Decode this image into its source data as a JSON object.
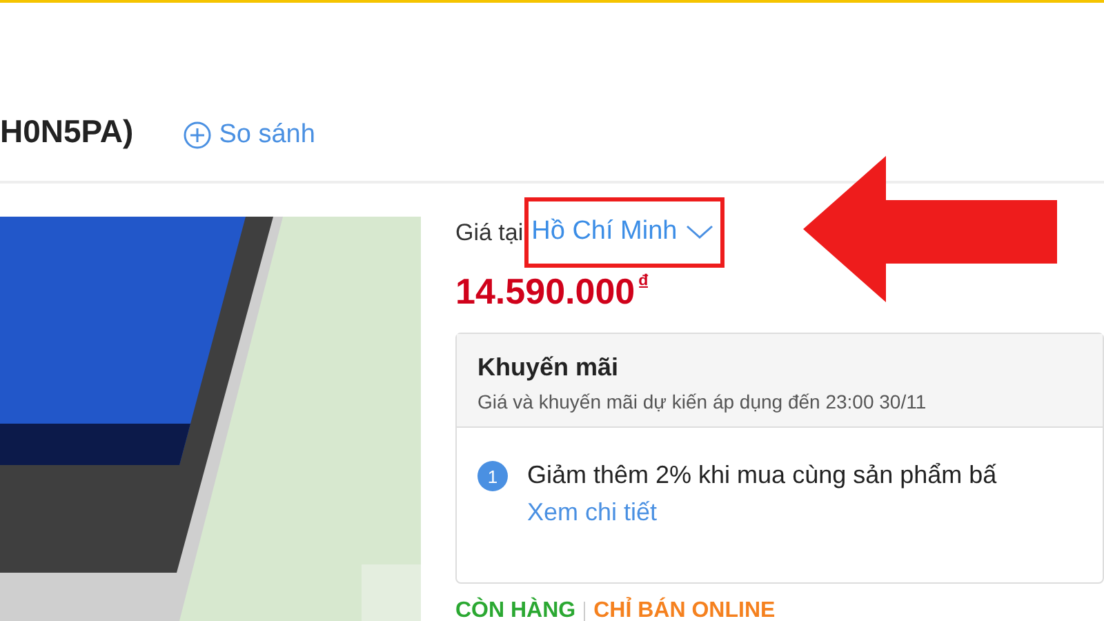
{
  "product_title": "H0N5PA)",
  "compare_link": "So sánh",
  "price": {
    "label": "Giá tại",
    "location": "Hồ Chí Minh",
    "amount": "14.590.000",
    "currency": "₫"
  },
  "promotion": {
    "title": "Khuyến mãi",
    "subtitle": "Giá và khuyến mãi dự kiến áp dụng đến 23:00 30/11",
    "items": [
      {
        "number": "1",
        "text": "Giảm thêm 2% khi mua cùng sản phẩm bấ",
        "link": "Xem chi tiết"
      }
    ]
  },
  "stock_status": [
    {
      "text": "CÒN HÀNG",
      "color": "#2ba832"
    },
    {
      "text": "CHỈ BÁN ONLINE",
      "color": "#f5811f"
    }
  ]
}
